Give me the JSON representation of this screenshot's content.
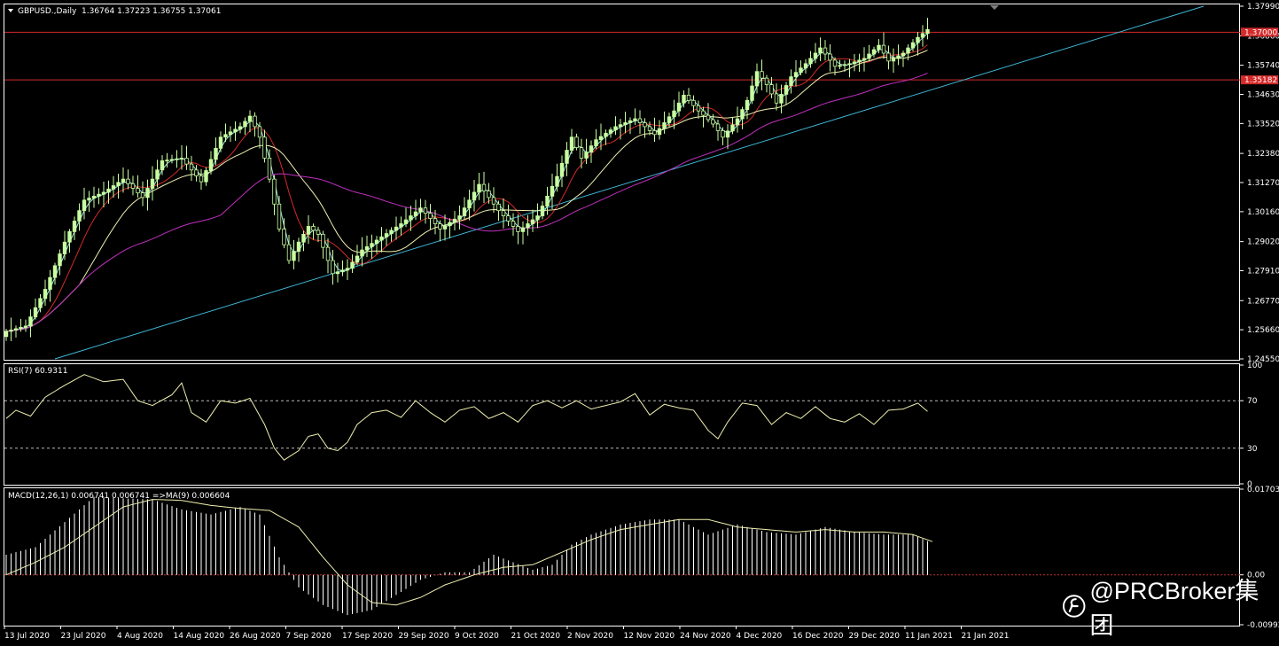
{
  "window": {
    "symbol_title": "GBPUSD.,Daily",
    "ohlc": "1.36764 1.37223 1.36755 1.37061",
    "watermark": "@PRCBroker集团"
  },
  "colors": {
    "background": "#000000",
    "bull": "#c8ffa0",
    "bear": "#000000",
    "ma_fast": "#9fe8e8",
    "ma_mid": "#d42a2a",
    "ma_slow": "#f0f0b0",
    "ma_long": "#c030c0",
    "trendline": "#3fb7d8",
    "hline": "#d42a2a",
    "rsi_line": "#f0f0b0",
    "macd_hist": "#ffffff",
    "macd_signal": "#f0f0b0",
    "zero_line": "#c03030"
  },
  "chart_data": [
    {
      "type": "candlestick",
      "title": "GBPUSD.,Daily",
      "ylim": [
        1.2455,
        1.3799
      ],
      "y_ticks": [
        "1.37990",
        "1.36860",
        "1.35740",
        "1.34630",
        "1.33520",
        "1.32380",
        "1.31270",
        "1.30160",
        "1.29020",
        "1.27910",
        "1.26770",
        "1.25660",
        "1.24550"
      ],
      "price_labels": [
        "1.37000",
        "1.35182"
      ],
      "horizontal_lines": [
        1.37,
        1.35182
      ],
      "x_labels": [
        "13 Jul 2020",
        "23 Jul 2020",
        "4 Aug 2020",
        "14 Aug 2020",
        "26 Aug 2020",
        "7 Sep 2020",
        "17 Sep 2020",
        "29 Sep 2020",
        "9 Oct 2020",
        "21 Oct 2020",
        "2 Nov 2020",
        "12 Nov 2020",
        "24 Nov 2020",
        "4 Dec 2020",
        "16 Dec 2020",
        "29 Dec 2020",
        "11 Jan 2021",
        "21 Jan 2021"
      ],
      "key_closes": [
        [
          0,
          1.256
        ],
        [
          4,
          1.258
        ],
        [
          8,
          1.272
        ],
        [
          12,
          1.29
        ],
        [
          16,
          1.306
        ],
        [
          20,
          1.309
        ],
        [
          24,
          1.314
        ],
        [
          28,
          1.307
        ],
        [
          32,
          1.321
        ],
        [
          36,
          1.322
        ],
        [
          40,
          1.313
        ],
        [
          44,
          1.33
        ],
        [
          48,
          1.334
        ],
        [
          50,
          1.338
        ],
        [
          52,
          1.33
        ],
        [
          54,
          1.314
        ],
        [
          56,
          1.295
        ],
        [
          58,
          1.283
        ],
        [
          60,
          1.29
        ],
        [
          62,
          1.296
        ],
        [
          64,
          1.293
        ],
        [
          67,
          1.278
        ],
        [
          70,
          1.28
        ],
        [
          73,
          1.287
        ],
        [
          77,
          1.292
        ],
        [
          81,
          1.297
        ],
        [
          85,
          1.303
        ],
        [
          89,
          1.295
        ],
        [
          93,
          1.3
        ],
        [
          97,
          1.312
        ],
        [
          101,
          1.302
        ],
        [
          105,
          1.294
        ],
        [
          109,
          1.3
        ],
        [
          113,
          1.315
        ],
        [
          116,
          1.33
        ],
        [
          118,
          1.322
        ],
        [
          121,
          1.329
        ],
        [
          125,
          1.334
        ],
        [
          129,
          1.337
        ],
        [
          133,
          1.331
        ],
        [
          137,
          1.34
        ],
        [
          139,
          1.346
        ],
        [
          142,
          1.34
        ],
        [
          145,
          1.335
        ],
        [
          147,
          1.33
        ],
        [
          150,
          1.337
        ],
        [
          152,
          1.344
        ],
        [
          154,
          1.355
        ],
        [
          156,
          1.35
        ],
        [
          158,
          1.343
        ],
        [
          161,
          1.353
        ],
        [
          164,
          1.358
        ],
        [
          167,
          1.364
        ],
        [
          170,
          1.357
        ],
        [
          173,
          1.358
        ],
        [
          176,
          1.36
        ],
        [
          179,
          1.365
        ],
        [
          181,
          1.359
        ],
        [
          184,
          1.362
        ],
        [
          187,
          1.368
        ],
        [
          189,
          1.371
        ]
      ]
    },
    {
      "type": "line",
      "title": "RSI(7) 60.9311",
      "ylim": [
        0,
        100
      ],
      "y_ticks": [
        "100",
        "70",
        "30",
        "0"
      ],
      "levels": [
        70,
        30
      ],
      "key_values": [
        [
          0,
          55
        ],
        [
          2,
          62
        ],
        [
          5,
          57
        ],
        [
          8,
          73
        ],
        [
          12,
          83
        ],
        [
          16,
          92
        ],
        [
          20,
          86
        ],
        [
          24,
          88
        ],
        [
          27,
          70
        ],
        [
          30,
          66
        ],
        [
          34,
          75
        ],
        [
          36,
          85
        ],
        [
          38,
          60
        ],
        [
          41,
          52
        ],
        [
          44,
          70
        ],
        [
          47,
          68
        ],
        [
          50,
          72
        ],
        [
          53,
          50
        ],
        [
          55,
          30
        ],
        [
          57,
          20
        ],
        [
          60,
          28
        ],
        [
          62,
          40
        ],
        [
          64,
          42
        ],
        [
          66,
          30
        ],
        [
          68,
          28
        ],
        [
          70,
          35
        ],
        [
          72,
          50
        ],
        [
          75,
          60
        ],
        [
          78,
          62
        ],
        [
          81,
          56
        ],
        [
          84,
          70
        ],
        [
          87,
          60
        ],
        [
          90,
          52
        ],
        [
          93,
          62
        ],
        [
          96,
          65
        ],
        [
          99,
          55
        ],
        [
          102,
          60
        ],
        [
          105,
          52
        ],
        [
          108,
          66
        ],
        [
          111,
          70
        ],
        [
          114,
          64
        ],
        [
          117,
          70
        ],
        [
          120,
          63
        ],
        [
          123,
          66
        ],
        [
          126,
          69
        ],
        [
          129,
          76
        ],
        [
          132,
          58
        ],
        [
          135,
          67
        ],
        [
          138,
          64
        ],
        [
          141,
          62
        ],
        [
          144,
          45
        ],
        [
          146,
          38
        ],
        [
          148,
          52
        ],
        [
          151,
          68
        ],
        [
          154,
          66
        ],
        [
          157,
          50
        ],
        [
          160,
          60
        ],
        [
          163,
          55
        ],
        [
          166,
          65
        ],
        [
          169,
          55
        ],
        [
          172,
          52
        ],
        [
          175,
          59
        ],
        [
          178,
          50
        ],
        [
          181,
          62
        ],
        [
          184,
          63
        ],
        [
          187,
          68
        ],
        [
          189,
          61
        ]
      ]
    },
    {
      "type": "bar",
      "title": "MACD(12,26,1) 0.006741 0.006741 =>MA(9) 0.006604",
      "ylim": [
        -0.00992,
        0.017035
      ],
      "y_ticks": [
        "0.017035",
        "0.00",
        "-0.00992"
      ],
      "key_hist": [
        [
          0,
          0.004
        ],
        [
          6,
          0.0055
        ],
        [
          12,
          0.0105
        ],
        [
          18,
          0.0155
        ],
        [
          24,
          0.0152
        ],
        [
          30,
          0.015
        ],
        [
          36,
          0.013
        ],
        [
          42,
          0.012
        ],
        [
          48,
          0.0135
        ],
        [
          52,
          0.012
        ],
        [
          56,
          0.0035
        ],
        [
          60,
          -0.0025
        ],
        [
          65,
          -0.006
        ],
        [
          70,
          -0.008
        ],
        [
          75,
          -0.007
        ],
        [
          80,
          -0.004
        ],
        [
          85,
          -0.001
        ],
        [
          90,
          0.0005
        ],
        [
          95,
          0.0005
        ],
        [
          100,
          0.004
        ],
        [
          104,
          0.0025
        ],
        [
          108,
          0.001
        ],
        [
          112,
          0.002
        ],
        [
          116,
          0.006
        ],
        [
          120,
          0.008
        ],
        [
          126,
          0.01
        ],
        [
          132,
          0.011
        ],
        [
          138,
          0.011
        ],
        [
          144,
          0.008
        ],
        [
          150,
          0.01
        ],
        [
          156,
          0.0085
        ],
        [
          162,
          0.008
        ],
        [
          168,
          0.0095
        ],
        [
          174,
          0.0085
        ],
        [
          180,
          0.008
        ],
        [
          186,
          0.008
        ],
        [
          189,
          0.0067
        ]
      ],
      "key_signal": [
        [
          0,
          0.0
        ],
        [
          6,
          0.0025
        ],
        [
          12,
          0.0055
        ],
        [
          18,
          0.0095
        ],
        [
          24,
          0.0135
        ],
        [
          30,
          0.015
        ],
        [
          36,
          0.0148
        ],
        [
          42,
          0.0138
        ],
        [
          48,
          0.0132
        ],
        [
          54,
          0.0128
        ],
        [
          60,
          0.0095
        ],
        [
          65,
          0.0035
        ],
        [
          70,
          -0.002
        ],
        [
          75,
          -0.0055
        ],
        [
          80,
          -0.006
        ],
        [
          85,
          -0.0045
        ],
        [
          90,
          -0.002
        ],
        [
          96,
          0.0
        ],
        [
          102,
          0.0015
        ],
        [
          108,
          0.002
        ],
        [
          114,
          0.0045
        ],
        [
          120,
          0.007
        ],
        [
          126,
          0.009
        ],
        [
          132,
          0.01
        ],
        [
          138,
          0.011
        ],
        [
          144,
          0.011
        ],
        [
          150,
          0.0095
        ],
        [
          156,
          0.009
        ],
        [
          162,
          0.0085
        ],
        [
          168,
          0.009
        ],
        [
          174,
          0.0085
        ],
        [
          180,
          0.0085
        ],
        [
          186,
          0.008
        ],
        [
          190,
          0.0066
        ]
      ]
    }
  ]
}
